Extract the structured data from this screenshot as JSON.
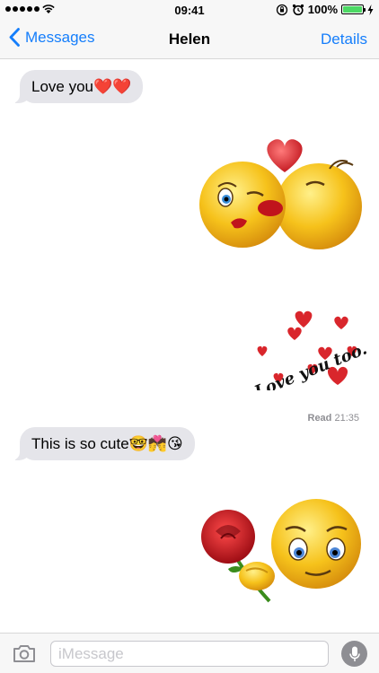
{
  "status_bar": {
    "time": "09:41",
    "battery": "100%",
    "signal_icon": "signal-dots-icon",
    "wifi_icon": "wifi-icon",
    "lock_icon": "rotation-lock-icon",
    "alarm_icon": "alarm-icon",
    "charging_icon": "charging-bolt-icon",
    "battery_level": 1.0
  },
  "nav": {
    "back_label": "Messages",
    "title": "Helen",
    "details_label": "Details",
    "accent": "#157efb"
  },
  "messages": [
    {
      "text": "Love you❤️❤️",
      "side": "incoming"
    },
    {
      "sticker": "kissing-emojis-heart-sticker",
      "side": "outgoing"
    },
    {
      "sticker": "love-you-too-hearts-sticker",
      "side": "outgoing",
      "text": "Love you too..."
    },
    {
      "text": "This is so cute🤓💏😘",
      "side": "incoming"
    },
    {
      "sticker": "smiley-holding-rose-sticker",
      "side": "outgoing"
    }
  ],
  "read_receipt": {
    "label": "Read",
    "time": "21:35"
  },
  "input": {
    "placeholder": "iMessage",
    "value": ""
  },
  "colors": {
    "bubble_gray": "#e5e5ea",
    "heart_red": "#d9262c",
    "emoji_yellow": "#f6c21b"
  }
}
